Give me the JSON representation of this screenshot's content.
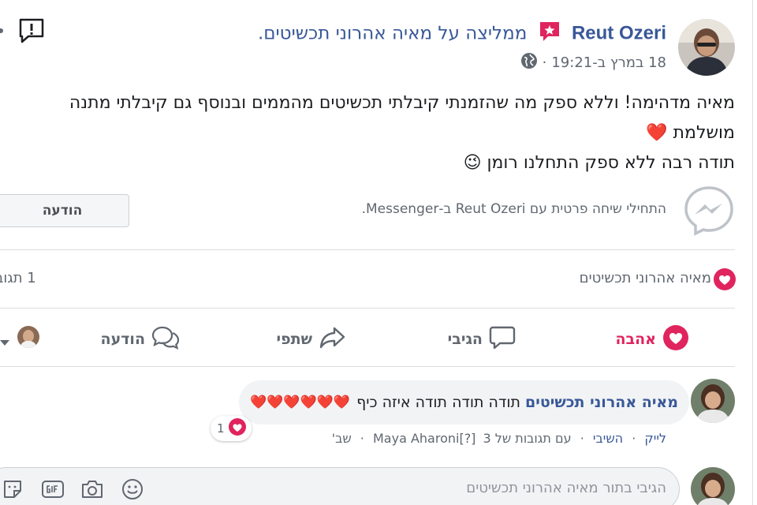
{
  "post": {
    "author_name": "Reut Ozeri",
    "recommends_text": "ממליצה על",
    "page_name": "מאיה אהרוני תכשיטים.",
    "timestamp": "18 במרץ ב-19:21",
    "separator": "·",
    "text_lines": [
      "מאיה מדהימה! וללא ספק מה שהזמנתי קיבלתי תכשיטים מהממים ובנוסף גם קיבלתי מתנה",
      "מושלמת ❤️",
      "תודה רבה ללא ספק התחלנו רומן 😉"
    ]
  },
  "messenger": {
    "prompt": "התחילי שיחה פרטית עם Reut Ozeri ב-Messenger.",
    "button_label": "הודעה"
  },
  "reactions": {
    "reacted_by": "מאיה אהרוני תכשיטים",
    "comments_count": "1 תגוב"
  },
  "actions": {
    "love": "אהבה",
    "comment": "הגיבי",
    "share": "שתפי",
    "message": "הודעה"
  },
  "comment": {
    "author": "מאיה אהרוני תכשיטים",
    "text": "תודה תודה תודה איזה כיף",
    "hearts": "❤️❤️❤️❤️❤️❤️",
    "like": "לייק",
    "reply": "השיבי",
    "dot": "·",
    "replies_text": "עם תגובות של 3",
    "replier": "Maya Aharoni[?]",
    "time": "שב'",
    "reaction_count": "1"
  },
  "reply_box": {
    "placeholder": "הגיבי בתור מאיה אהרוני תכשיטים"
  },
  "colors": {
    "link": "#385898",
    "love": "#e0245e",
    "secondary_text": "#606770",
    "messenger": "#4b4f56"
  },
  "icons": [
    "report-icon",
    "recommend-flag-icon",
    "globe-icon",
    "messenger-icon",
    "heart-reaction-icon",
    "comment-icon",
    "share-icon",
    "message-icon",
    "caret-down-icon",
    "emoji-icon",
    "camera-icon",
    "gif-icon",
    "sticker-icon"
  ]
}
